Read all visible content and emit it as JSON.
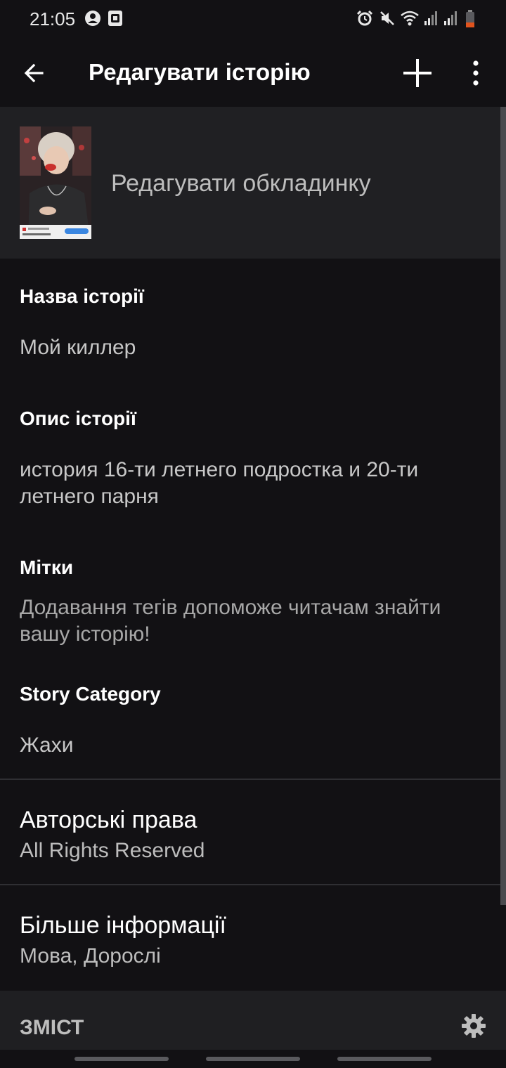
{
  "status_bar": {
    "time": "21:05"
  },
  "app_bar": {
    "title": "Редагувати історію"
  },
  "cover": {
    "label": "Редагувати обкладинку"
  },
  "fields": {
    "title_label": "Назва історії",
    "title_value": "Мой киллер",
    "description_label": "Опис історії",
    "description_value": "история 16-ти летнего подростка и 20-ти летнего парня",
    "tags_label": "Мітки",
    "tags_hint": "Додавання тегів допоможе читачам знайти вашу історію!",
    "category_label": "Story Category",
    "category_value": "Жахи"
  },
  "copyright": {
    "label": "Авторські права",
    "value": "All Rights Reserved"
  },
  "more_info": {
    "label": "Більше інформації",
    "value": "Мова, Дорослі"
  },
  "contents": {
    "label": "ЗМІСТ"
  },
  "colors": {
    "background": "#121114",
    "surface": "#202023",
    "text_primary": "#ffffff",
    "text_secondary": "#bdbdbd",
    "battery_low": "#e0531d"
  },
  "icons": [
    "profile-icon",
    "screenshot-icon",
    "alarm-icon",
    "mute-icon",
    "wifi-icon",
    "signal-icon",
    "battery-icon",
    "back-arrow-icon",
    "add-icon",
    "more-vert-icon",
    "gear-icon"
  ]
}
